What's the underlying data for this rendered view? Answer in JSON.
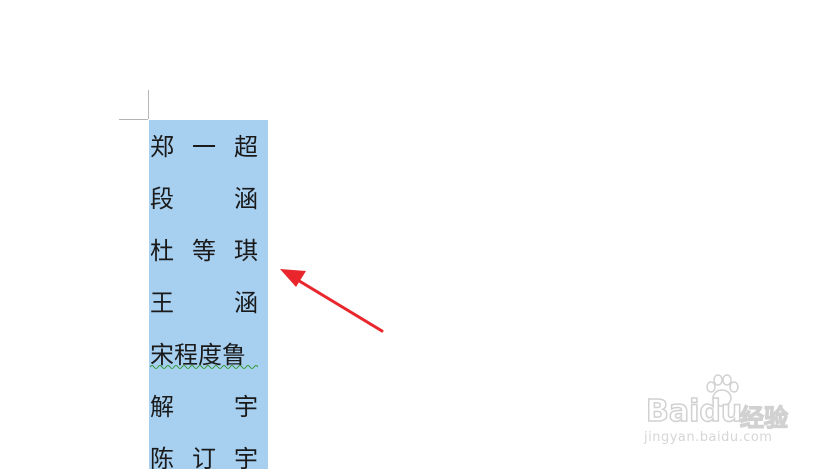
{
  "document": {
    "lines": [
      {
        "chars": [
          "郑",
          "一",
          "超"
        ],
        "layout": "justify"
      },
      {
        "chars": [
          "段",
          "涵"
        ],
        "layout": "justify"
      },
      {
        "chars": [
          "杜",
          "等",
          "琪"
        ],
        "layout": "justify"
      },
      {
        "chars": [
          "王",
          "涵"
        ],
        "layout": "justify"
      },
      {
        "text": "宋程度鲁",
        "layout": "full",
        "spellcheck": true
      },
      {
        "chars": [
          "解",
          "宇"
        ],
        "layout": "justify"
      },
      {
        "chars": [
          "陈",
          "订",
          "宇"
        ],
        "layout": "justify"
      }
    ],
    "selection_color": "#a6cff0",
    "spellcheck_color": "#3a9a3a"
  },
  "annotation": {
    "arrow_color": "#e8262b",
    "arrow_icon": "red-arrow-icon"
  },
  "watermark": {
    "brand": "Bai",
    "brand_suffix": "du",
    "product": "经验",
    "url": "jingyan.baidu.com",
    "icon": "paw-icon"
  }
}
